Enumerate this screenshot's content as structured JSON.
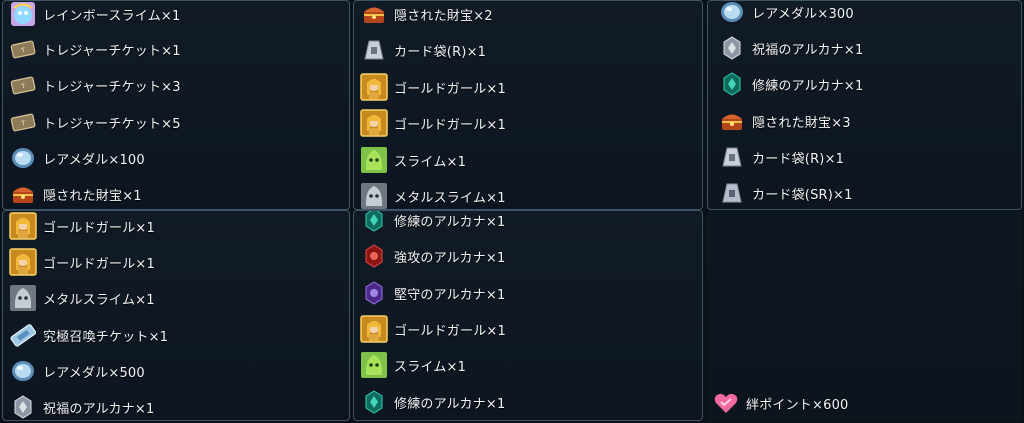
{
  "panels": [
    {
      "items": [
        {
          "icon": "rainbow-slime-icon",
          "label": "レインボースライム×1"
        },
        {
          "icon": "treasure-ticket-icon",
          "label": "トレジャーチケット×1"
        },
        {
          "icon": "treasure-ticket-icon",
          "label": "トレジャーチケット×3"
        },
        {
          "icon": "treasure-ticket-icon",
          "label": "トレジャーチケット×5"
        },
        {
          "icon": "rare-medal-icon",
          "label": "レアメダル×100"
        },
        {
          "icon": "hidden-treasure-icon",
          "label": "隠された財宝×1"
        }
      ]
    },
    {
      "items": [
        {
          "icon": "hidden-treasure-icon",
          "label": "隠された財宝×2"
        },
        {
          "icon": "card-bag-icon",
          "label": "カード袋(R)×1"
        },
        {
          "icon": "gold-girl-icon",
          "label": "ゴールドガール×1"
        },
        {
          "icon": "gold-girl-icon",
          "label": "ゴールドガール×1"
        },
        {
          "icon": "slime-icon",
          "label": "スライム×1"
        },
        {
          "icon": "metal-slime-icon",
          "label": "メタルスライム×1"
        }
      ]
    },
    {
      "items": [
        {
          "icon": "rare-medal-icon",
          "label": "レアメダル×300"
        },
        {
          "icon": "blessing-arcana-icon",
          "label": "祝福のアルカナ×1"
        },
        {
          "icon": "training-arcana-icon",
          "label": "修練のアルカナ×1"
        },
        {
          "icon": "hidden-treasure-icon",
          "label": "隠された財宝×3"
        },
        {
          "icon": "card-bag-icon",
          "label": "カード袋(R)×1"
        },
        {
          "icon": "card-bag-sr-icon",
          "label": "カード袋(SR)×1"
        }
      ]
    },
    {
      "items": [
        {
          "icon": "gold-girl-icon",
          "label": "ゴールドガール×1"
        },
        {
          "icon": "gold-girl-icon",
          "label": "ゴールドガール×1"
        },
        {
          "icon": "metal-slime-icon",
          "label": "メタルスライム×1"
        },
        {
          "icon": "ultimate-summon-ticket-icon",
          "label": "究極召喚チケット×1"
        },
        {
          "icon": "rare-medal-icon",
          "label": "レアメダル×500"
        },
        {
          "icon": "blessing-arcana-icon",
          "label": "祝福のアルカナ×1"
        }
      ]
    },
    {
      "items": [
        {
          "icon": "training-arcana-icon",
          "label": "修練のアルカナ×1"
        },
        {
          "icon": "strong-attack-arcana-icon",
          "label": "強攻のアルカナ×1"
        },
        {
          "icon": "steadfast-arcana-icon",
          "label": "堅守のアルカナ×1"
        },
        {
          "icon": "gold-girl-icon",
          "label": "ゴールドガール×1"
        },
        {
          "icon": "slime-icon",
          "label": "スライム×1"
        },
        {
          "icon": "training-arcana-icon",
          "label": "修練のアルカナ×1"
        }
      ]
    },
    {
      "items": [
        {
          "icon": "bond-points-icon",
          "label": "絆ポイント×600"
        }
      ]
    }
  ]
}
